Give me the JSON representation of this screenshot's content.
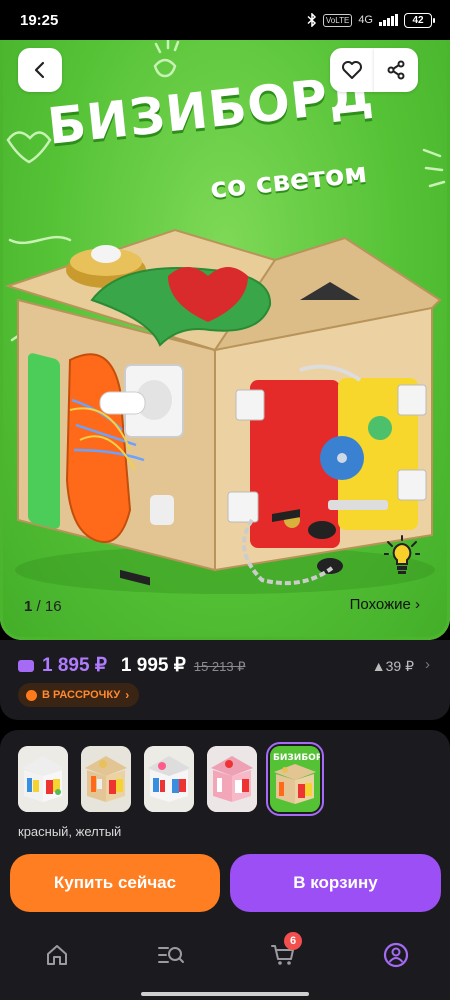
{
  "status_bar": {
    "time": "19:25",
    "network": "4G",
    "battery": "42",
    "badges": [
      "VoLTE",
      "VoLTE"
    ]
  },
  "hero": {
    "title": "БИЗИБОРД",
    "subtitle": "со светом",
    "counter_current": "1",
    "counter_total": "/ 16",
    "similar_label": "Похожие ›",
    "icons": [
      "back-arrow-icon",
      "heart-icon",
      "share-icon",
      "light-bulb-icon"
    ],
    "colors": {
      "green": "#55c236",
      "dark_green": "#2f8d1b"
    }
  },
  "price": {
    "main": "1 895 ₽",
    "card": "1 995 ₽",
    "old": "15 213 ₽",
    "delta": "▲39 ₽",
    "installment_label": "В РАССРОЧКУ",
    "colors": {
      "main": "#b07cff",
      "installment": "#ff8a30"
    }
  },
  "variants": {
    "label": "красный, желтый",
    "selected_index": 4,
    "count": 5
  },
  "actions": {
    "buy_now": "Купить сейчас",
    "add_to_cart": "В корзину",
    "colors": {
      "buy_now": "#ff7e21",
      "add_to_cart": "#9b4ff5"
    }
  },
  "bottom_nav": {
    "items": [
      "home",
      "catalog",
      "cart",
      "profile"
    ],
    "cart_count": "6",
    "active": "profile"
  }
}
